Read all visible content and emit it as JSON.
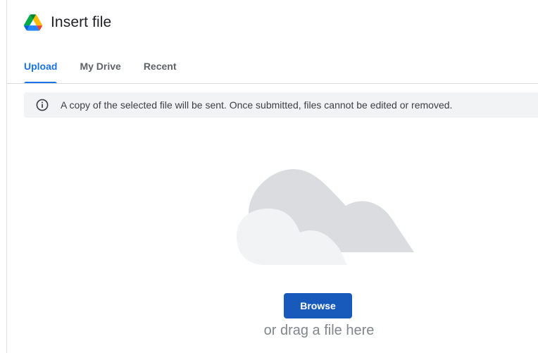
{
  "dialog": {
    "title": "Insert file",
    "logo_icon": "google-drive-icon"
  },
  "tabs": [
    {
      "label": "Upload",
      "active": true
    },
    {
      "label": "My Drive",
      "active": false
    },
    {
      "label": "Recent",
      "active": false
    }
  ],
  "notice": {
    "icon": "info-icon",
    "text": "A copy of the selected file will be sent. Once submitted, files cannot be edited or removed."
  },
  "upload": {
    "illustration_icon": "cloud-icon",
    "browse_label": "Browse",
    "drag_text": "or drag a file here"
  },
  "colors": {
    "accent": "#1a73e8",
    "button": "#185abc",
    "notice_bg": "#f1f3f4",
    "cloud_back": "#dadce0",
    "cloud_front": "#f1f3f4"
  }
}
